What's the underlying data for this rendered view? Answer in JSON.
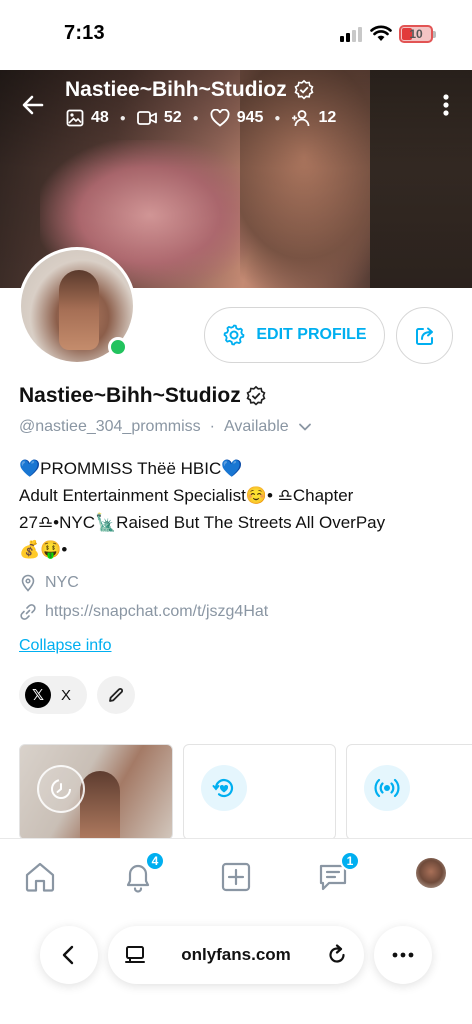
{
  "status_bar": {
    "time": "7:13",
    "battery": "10"
  },
  "header": {
    "title": "Nastiee~Bihh~Studioz",
    "stats": [
      {
        "icon": "image-icon",
        "value": "48"
      },
      {
        "icon": "video-icon",
        "value": "52"
      },
      {
        "icon": "heart-icon",
        "value": "945"
      },
      {
        "icon": "fans-icon",
        "value": "12"
      }
    ]
  },
  "actions": {
    "edit_profile": "EDIT PROFILE"
  },
  "profile": {
    "name": "Nastiee~Bihh~Studioz",
    "handle": "@nastiee_304_prommiss",
    "separator": "·",
    "availability": "Available",
    "bio_lines": [
      "💙PROMMISS Thëë HBIC💙",
      "Adult Entertainment Specialist☺️• ♎Chapter",
      "27♎•NYC🗽Raised But The Streets All OverPay",
      "💰🤑•"
    ],
    "location": "NYC",
    "link": "https://snapchat.com/t/jszg4Hat",
    "collapse_label": "Collapse info",
    "social_label": "X",
    "social_logo": "𝕏"
  },
  "bottom_nav": {
    "notifications_badge": "4",
    "messages_badge": "1"
  },
  "browser": {
    "url": "onlyfans.com"
  },
  "colors": {
    "accent": "#00aff0",
    "online": "#22c35e",
    "muted": "#8a96a3"
  }
}
